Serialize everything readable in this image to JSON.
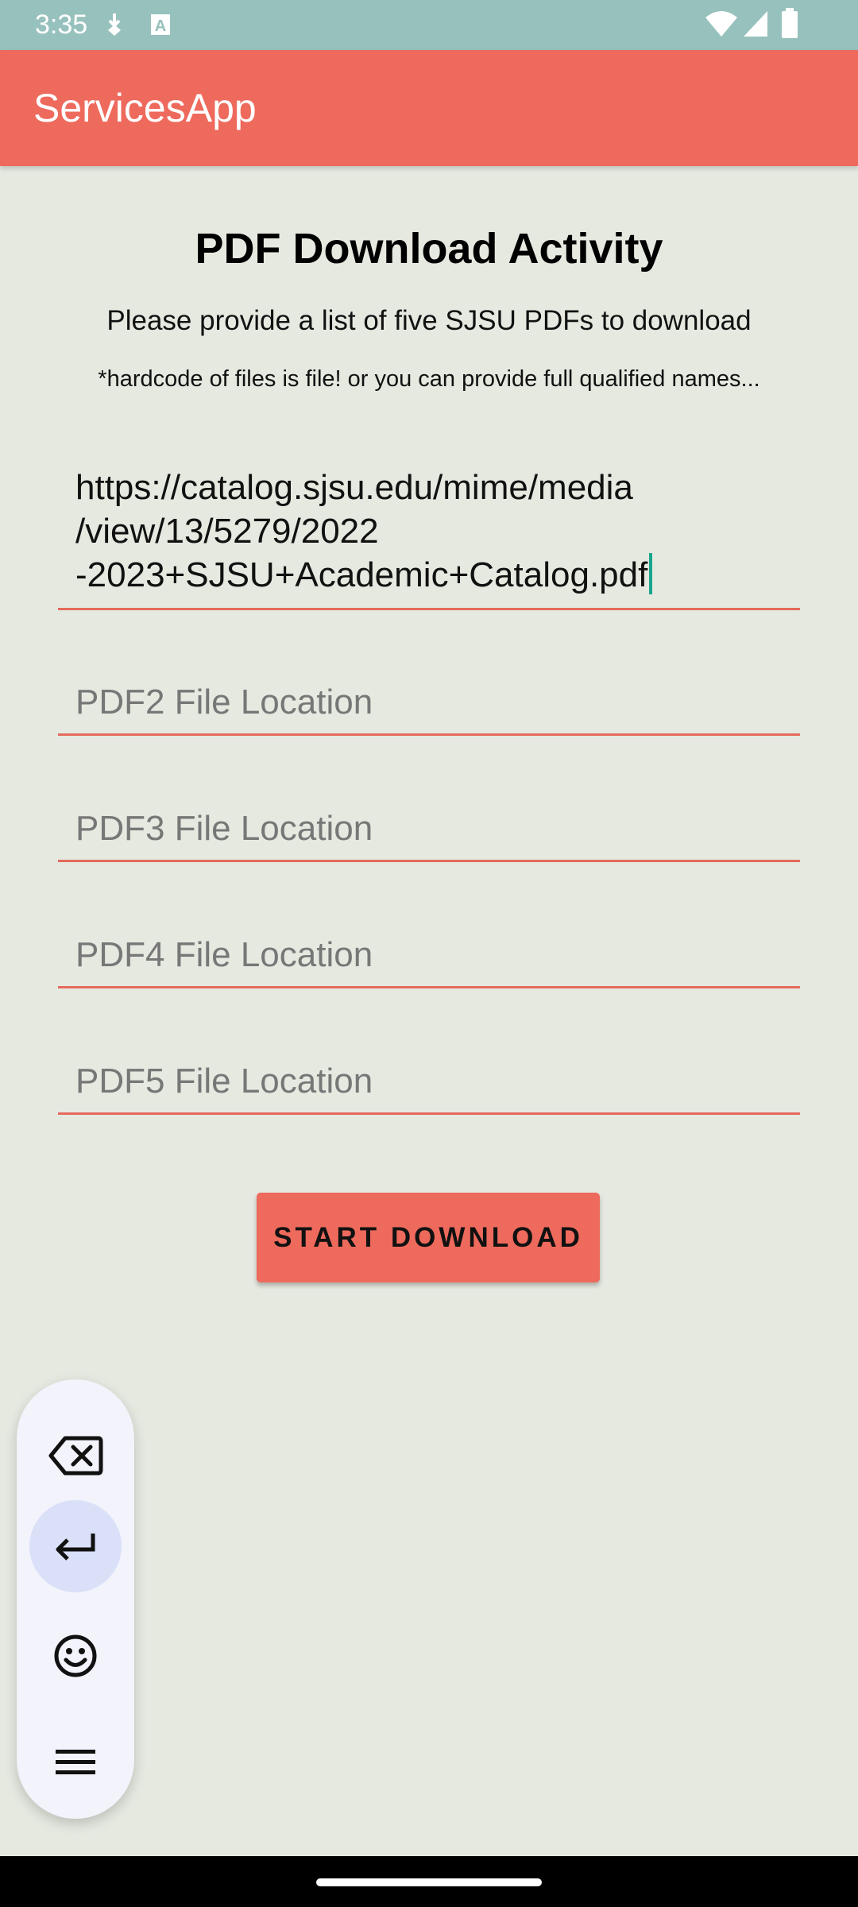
{
  "status_bar": {
    "time": "3:35",
    "icons": [
      "download-shield-icon",
      "keyboard-a-icon",
      "wifi-icon",
      "signal-icon",
      "battery-icon"
    ]
  },
  "app_bar": {
    "title": "ServicesApp",
    "color": "#ee6a5c"
  },
  "main": {
    "title": "PDF Download Activity",
    "subtitle": "Please provide a list of five SJSU PDFs to download",
    "note": "*hardcode of files is file! or you can provide full qualified names...",
    "fields": [
      {
        "value": "https://catalog.sjsu.edu/mime/media\n/view/13/5279/2022\n-2023+SJSU+Academic+Catalog.pdf",
        "placeholder": ""
      },
      {
        "value": "",
        "placeholder": "PDF2 File Location"
      },
      {
        "value": "",
        "placeholder": "PDF3 File Location"
      },
      {
        "value": "",
        "placeholder": "PDF4 File Location"
      },
      {
        "value": "",
        "placeholder": "PDF5 File Location"
      }
    ],
    "start_button_label": "START DOWNLOAD"
  },
  "keyboard_toolbar": {
    "items": [
      "backspace-icon",
      "enter-icon",
      "emoji-icon",
      "menu-icon"
    ]
  },
  "colors": {
    "accent": "#ee6a5c",
    "background": "#e5e9e0",
    "status_bar": "#97c1bc",
    "cursor": "#19a68f"
  }
}
